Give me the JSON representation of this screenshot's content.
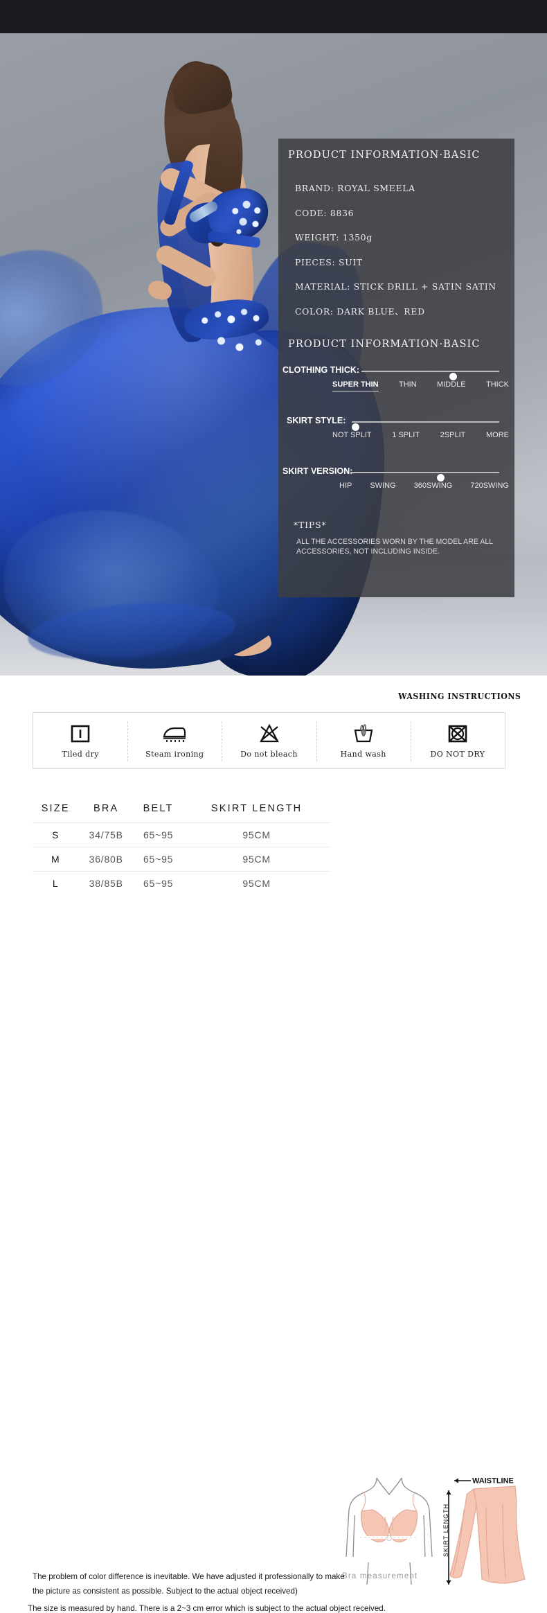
{
  "panel": {
    "title": "PRODUCT INFORMATION·BASIC",
    "title2": "PRODUCT INFORMATION·BASIC",
    "specs": [
      "BRAND: ROYAL SMEELA",
      "CODE:  8836",
      "WEIGHT: 1350g",
      "PIECES: SUIT",
      "MATERIAL: STICK DRILL + SATIN SATIN",
      "COLOR: DARK BLUE、RED"
    ],
    "sliders": [
      {
        "label": "CLOTHING THICK:",
        "options": [
          "SUPER THIN",
          "THIN",
          "MIDDLE",
          "THICK"
        ],
        "active_index": 0,
        "knob_index": 2
      },
      {
        "label": "SKIRT STYLE:",
        "options": [
          "NOT SPLIT",
          "1 SPLIT",
          "2SPLIT",
          "MORE"
        ],
        "active_index": -1,
        "knob_index": 0
      },
      {
        "label": "SKIRT VERSION:",
        "options": [
          "HIP",
          "SWING",
          "360SWING",
          "720SWING"
        ],
        "active_index": -1,
        "knob_index": 2
      }
    ],
    "tips_title": "*TIPS*",
    "tips_body": "ALL THE ACCESSORIES WORN BY THE MODEL ARE ALL ACCESSORIES, NOT INCLUDING INSIDE."
  },
  "washing": {
    "title": "WASHING INSTRUCTIONS",
    "items": [
      {
        "icon": "tiled-dry-icon",
        "label": "Tiled dry"
      },
      {
        "icon": "steam-ironing-icon",
        "label": "Steam ironing"
      },
      {
        "icon": "do-not-bleach-icon",
        "label": "Do not bleach"
      },
      {
        "icon": "hand-wash-icon",
        "label": "Hand wash"
      },
      {
        "icon": "do-not-dry-icon",
        "label": "DO NOT DRY"
      }
    ]
  },
  "size_table": {
    "headers": [
      "SIZE",
      "BRA",
      "BELT",
      "SKIRT LENGTH"
    ],
    "rows": [
      [
        "S",
        "34/75B",
        "65~95",
        "95CM"
      ],
      [
        "M",
        "36/80B",
        "65~95",
        "95CM"
      ],
      [
        "L",
        "38/85B",
        "65~95",
        "95CM"
      ]
    ]
  },
  "notes": {
    "note1": "The problem of color difference is inevitable. We have adjusted it professionally to make the picture as consistent as possible. Subject to the actual object received)",
    "note2": "The size is measured by hand. There is a 2~3 cm error which is subject to the actual object received."
  },
  "diagrams": {
    "bra_caption": "Bra measurement",
    "waistline_label": "WAISTLINE",
    "skirt_length_label": "SKIRT LENGTH"
  },
  "colors": {
    "top_bar": "#1a1c22",
    "panel_bg": "rgba(60,62,66,0.86)",
    "costume_blue": "#1f46bb",
    "diagram_pink": "#f6c6b4"
  }
}
